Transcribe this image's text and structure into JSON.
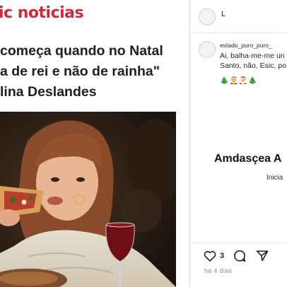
{
  "article": {
    "brand": "ic noticias",
    "headline": [
      "começa quando no Natal",
      "a de rei e não de rainha\"",
      "lina Deslandes"
    ]
  },
  "post": {
    "top_username": "L",
    "caption": {
      "username": "estado_puro_puro_",
      "lines": [
        "Ai, balha-me-me un",
        "Santo, não, Esic, po"
      ],
      "emojis": "🎄🤶🎅🎄"
    },
    "banner_title": "Amdasçea A",
    "banner_subtitle": "Inicia",
    "like_count": "3",
    "time_ago": "há 4 dias"
  }
}
